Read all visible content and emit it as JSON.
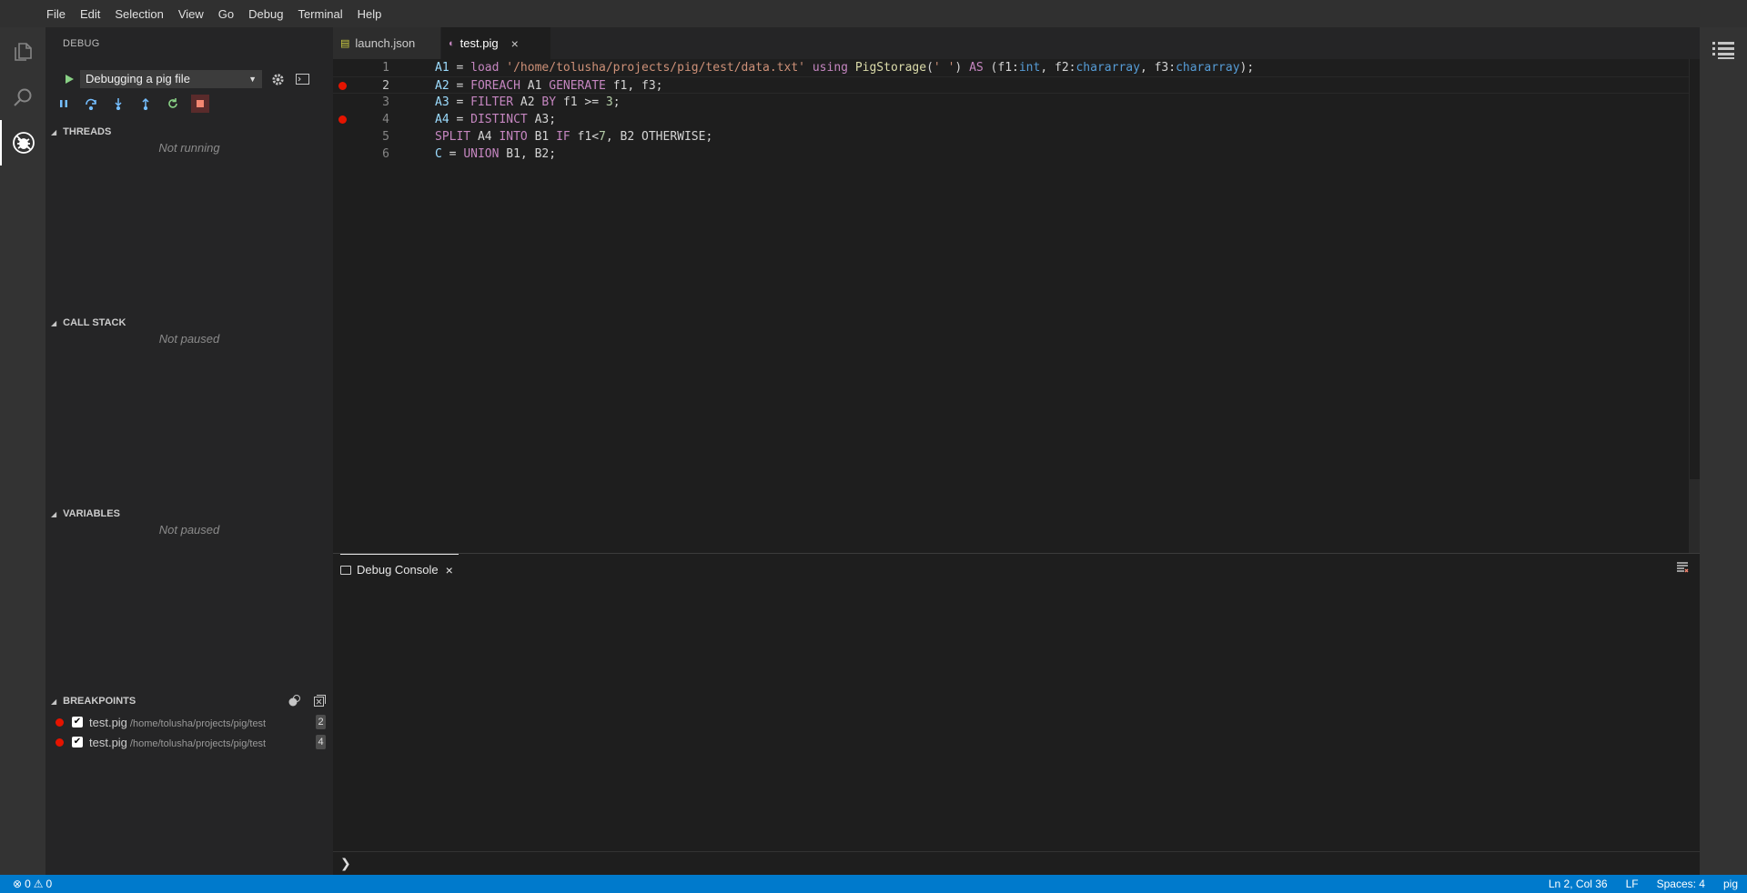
{
  "menu": [
    "File",
    "Edit",
    "Selection",
    "View",
    "Go",
    "Debug",
    "Terminal",
    "Help"
  ],
  "sidebar": {
    "title": "DEBUG",
    "config": "Debugging a pig file",
    "sections": {
      "threads": {
        "title": "THREADS",
        "status": "Not running"
      },
      "call_stack": {
        "title": "CALL STACK",
        "status": "Not paused"
      },
      "variables": {
        "title": "VARIABLES",
        "status": "Not paused"
      },
      "breakpoints": {
        "title": "BREAKPOINTS",
        "items": [
          {
            "file": "test.pig",
            "path": "/home/tolusha/projects/pig/test",
            "line": "2"
          },
          {
            "file": "test.pig",
            "path": "/home/tolusha/projects/pig/test",
            "line": "4"
          }
        ]
      }
    }
  },
  "tabs": [
    {
      "label": "launch.json",
      "icon": "json-file-icon"
    },
    {
      "label": "test.pig",
      "icon": "pig-file-icon",
      "close": "×"
    }
  ],
  "editor": {
    "lines": [
      {
        "num": "1",
        "breakpoint": false
      },
      {
        "num": "2",
        "breakpoint": true
      },
      {
        "num": "3",
        "breakpoint": false
      },
      {
        "num": "4",
        "breakpoint": true
      },
      {
        "num": "5",
        "breakpoint": false
      },
      {
        "num": "6",
        "breakpoint": false
      }
    ],
    "code": {
      "l1": [
        "A1",
        " = ",
        "load",
        " ",
        "'/home/tolusha/projects/pig/test/data.txt'",
        " ",
        "using",
        " ",
        "PigStorage",
        "(",
        "' '",
        ") ",
        "AS",
        " (f1:",
        "int",
        ", f2:",
        "chararray",
        ", f3:",
        "chararray",
        ");"
      ],
      "l2": [
        "A2",
        " = ",
        "FOREACH",
        " A1 ",
        "GENERATE",
        " f1, f3;"
      ],
      "l3": [
        "A3",
        " = ",
        "FILTER",
        " A2 ",
        "BY",
        " f1 >= ",
        "3",
        ";"
      ],
      "l4": [
        "A4",
        " = ",
        "DISTINCT",
        " A3;"
      ],
      "l5": [
        "SPLIT",
        " A4 ",
        "INTO",
        " B1 ",
        "IF",
        " f1<",
        "7",
        ", B2 OTHERWISE;"
      ],
      "l6": [
        "C",
        " = ",
        "UNION",
        " B1, B2;"
      ]
    }
  },
  "panel": {
    "tab": "Debug Console",
    "close": "×",
    "prompt": "❯"
  },
  "status": {
    "errors": "0",
    "warnings": "0",
    "position": "Ln 2, Col 36",
    "eol": "LF",
    "indent": "Spaces: 4",
    "language": "pig"
  }
}
